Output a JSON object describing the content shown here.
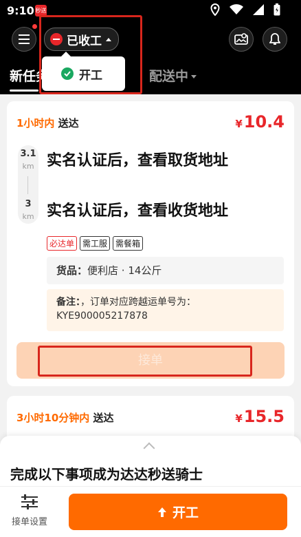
{
  "status_bar": {
    "time": "9:10",
    "app_badge": "秒送"
  },
  "header": {
    "work_state": "已收工",
    "dropdown_option": "开工",
    "tabs": [
      {
        "label": "新任务",
        "active": true
      },
      {
        "label": "配送中",
        "active": false
      }
    ]
  },
  "orders": [
    {
      "eta_highlight": "1小时内",
      "eta_suffix": "送达",
      "price_symbol": "¥",
      "price": "10.4",
      "pickup_distance": "3.1",
      "pickup_unit": "km",
      "delivery_distance": "3",
      "delivery_unit": "km",
      "pickup_address": "实名认证后，查看取货地址",
      "delivery_address": "实名认证后，查看收货地址",
      "tags": [
        "必达单",
        "需工服",
        "需餐箱"
      ],
      "goods_label": "货品：",
      "goods_value": "便利店 · 14公斤",
      "note_label": "备注：",
      "note_value": "，订单对应跨越运单号为：KYE900005217878",
      "accept_label": "接单"
    },
    {
      "eta_highlight": "3小时10分钟内",
      "eta_suffix": "送达",
      "price_symbol": "¥",
      "price": "15.5"
    }
  ],
  "sheet": {
    "title": "完成以下事项成为达达秒送骑士"
  },
  "bottom": {
    "settings_label": "接单设置",
    "start_label": "开工"
  },
  "colors": {
    "accent": "#ff6a00",
    "price": "#e8262a",
    "highlight_box": "#d8261c",
    "success": "#1aa860"
  }
}
